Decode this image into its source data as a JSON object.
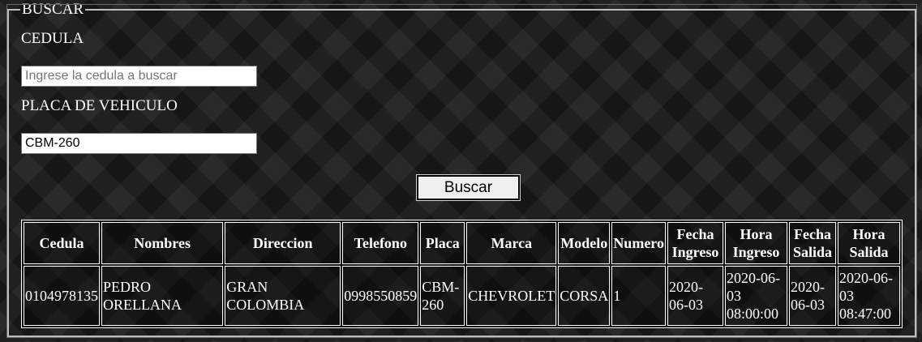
{
  "search": {
    "legend": "BUSCAR",
    "cedula_label": "CEDULA",
    "cedula_placeholder": "Ingrese la cedula a buscar",
    "cedula_value": "",
    "placa_label": "PLACA DE VEHICULO",
    "placa_value": "CBM-260",
    "button_label": "Buscar"
  },
  "table": {
    "headers": [
      "Cedula",
      "Nombres",
      "Direccion",
      "Telefono",
      "Placa",
      "Marca",
      "Modelo",
      "Numero",
      "Fecha Ingreso",
      "Hora Ingreso",
      "Fecha Salida",
      "Hora Salida"
    ],
    "rows": [
      [
        "0104978135",
        "PEDRO ORELLANA",
        "GRAN COLOMBIA",
        "0998550859",
        "CBM-260",
        "CHEVROLET",
        "CORSA",
        "1",
        "2020-06-03",
        "2020-06-03 08:00:00",
        "2020-06-03",
        "2020-06-03 08:47:00"
      ]
    ]
  }
}
